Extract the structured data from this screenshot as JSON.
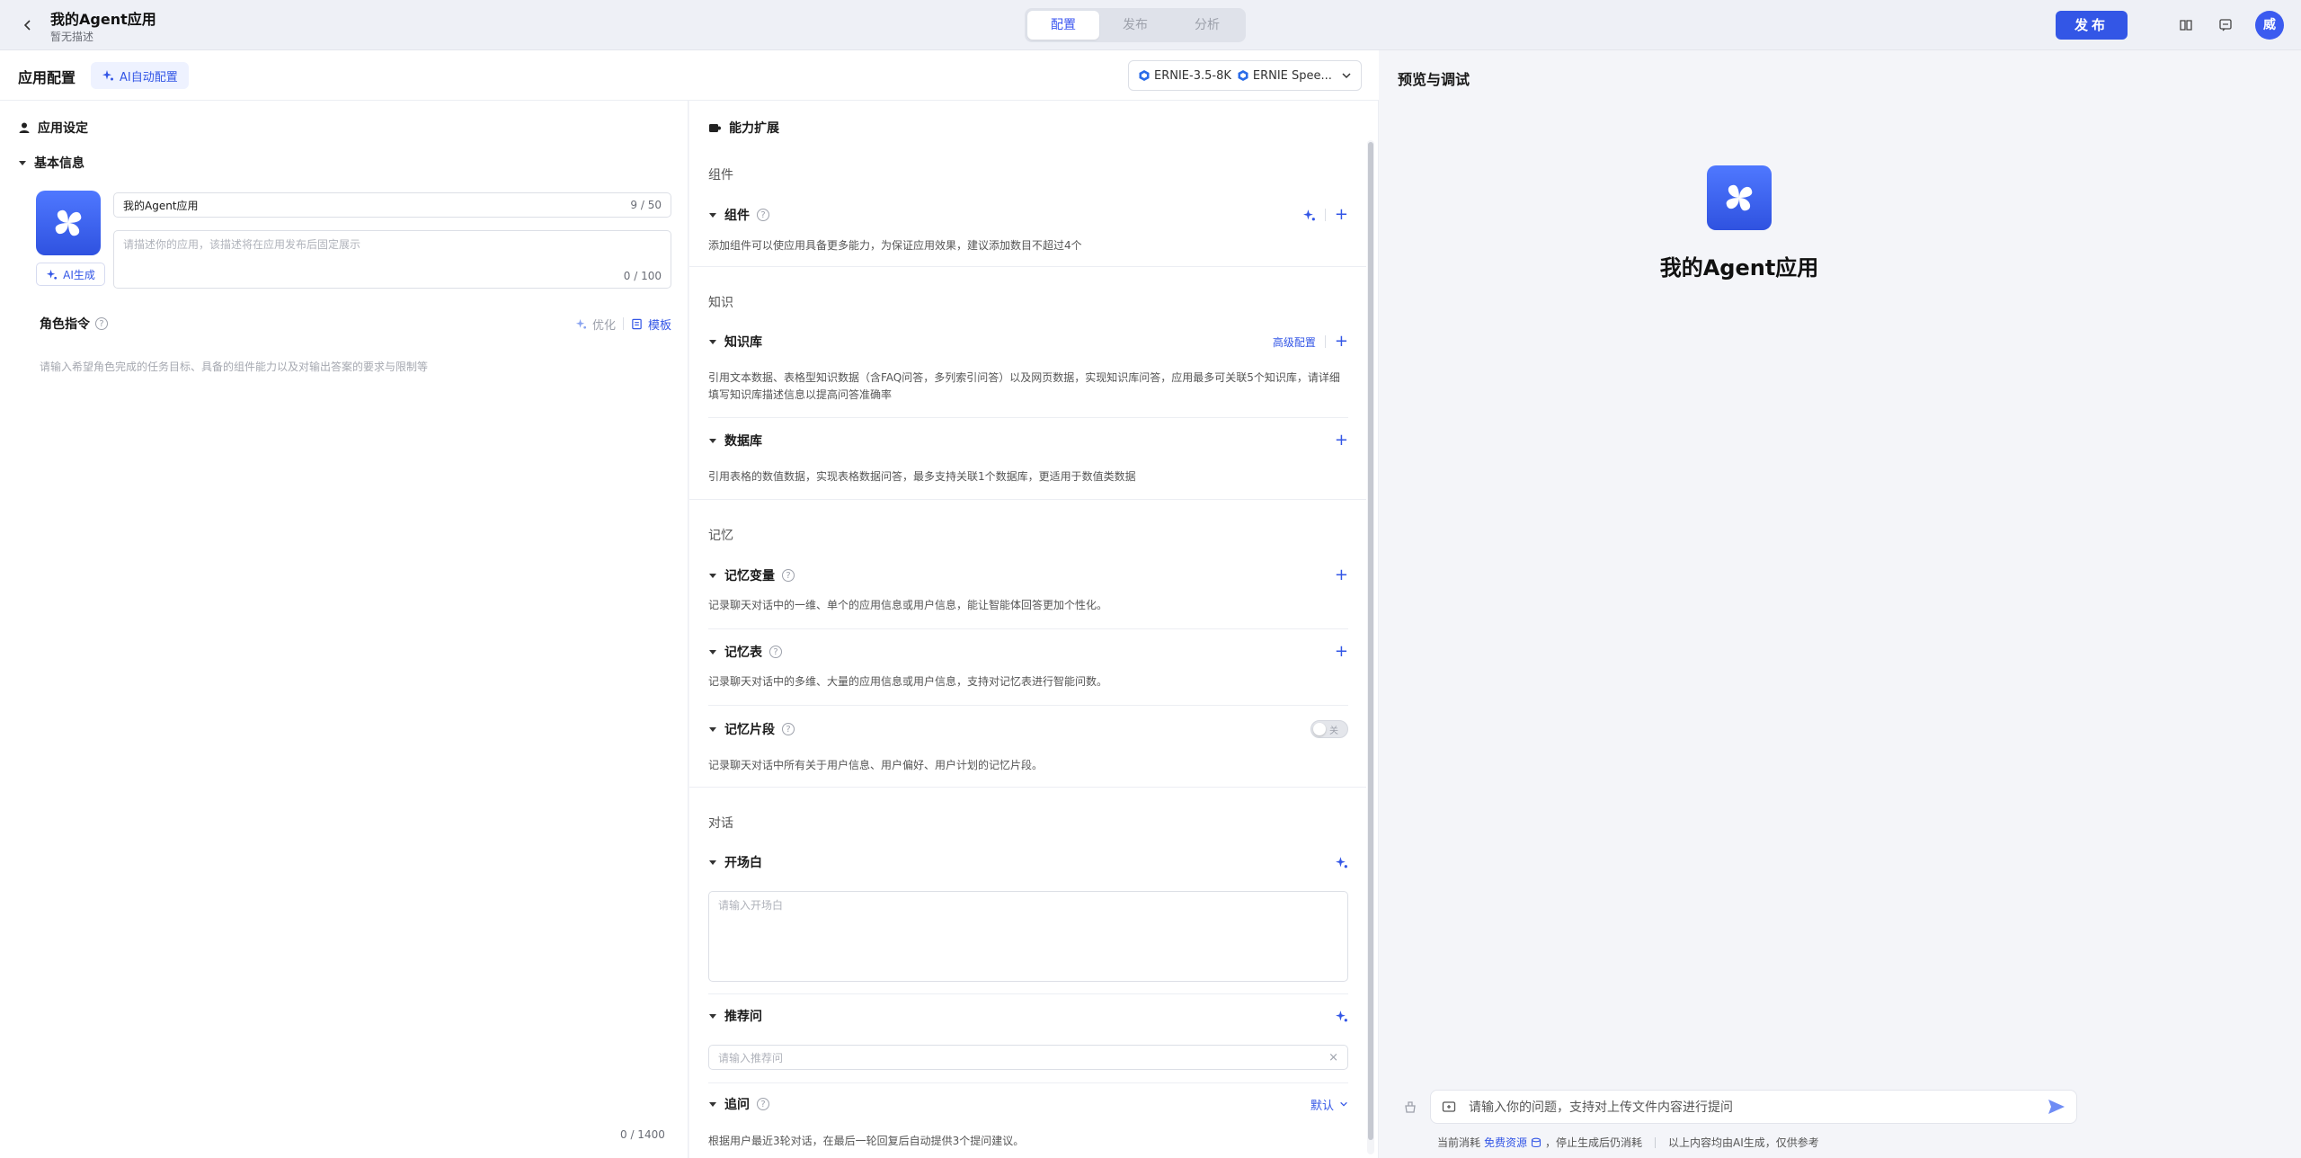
{
  "header": {
    "app_title": "我的Agent应用",
    "app_subtitle": "暂无描述",
    "tabs": [
      {
        "label": "配置",
        "active": true
      },
      {
        "label": "发布",
        "active": false
      },
      {
        "label": "分析",
        "active": false
      }
    ],
    "publish_label": "发布",
    "avatar_text": "威",
    "icons": [
      "back-icon",
      "book-icon",
      "message-icon"
    ],
    "accent_color": "#3356e6"
  },
  "config": {
    "title": "应用配置",
    "ai_auto_label": "AI自动配置",
    "models": [
      "ERNIE-3.5-8K",
      "ERNIE Spee..."
    ]
  },
  "left": {
    "app_settings_title": "应用设定",
    "basic_info_title": "基本信息",
    "ai_generate_label": "AI生成",
    "name_value": "我的Agent应用",
    "name_counter": "9 / 50",
    "desc_placeholder": "请描述你的应用，该描述将在应用发布后固定展示",
    "desc_counter": "0 / 100",
    "role_title": "角色指令",
    "optimize_label": "优化",
    "template_label": "模板",
    "role_placeholder": "请输入希望角色完成的任务目标、具备的组件能力以及对输出答案的要求与限制等",
    "role_counter": "0 / 1400"
  },
  "middle": {
    "title": "能力扩展",
    "groups": {
      "components": "组件",
      "knowledge": "知识",
      "memory": "记忆",
      "dialogue": "对话"
    },
    "component": {
      "title": "组件",
      "desc": "添加组件可以使应用具备更多能力，为保证应用效果，建议添加数目不超过4个"
    },
    "kb": {
      "title": "知识库",
      "advanced_label": "高级配置",
      "desc": "引用文本数据、表格型知识数据（含FAQ问答，多列索引问答）以及网页数据，实现知识库问答，应用最多可关联5个知识库，请详细填写知识库描述信息以提高问答准确率"
    },
    "db": {
      "title": "数据库",
      "desc": "引用表格的数值数据，实现表格数据问答，最多支持关联1个数据库，更适用于数值类数据"
    },
    "mem_var": {
      "title": "记忆变量",
      "desc": "记录聊天对话中的一维、单个的应用信息或用户信息，能让智能体回答更加个性化。"
    },
    "mem_table": {
      "title": "记忆表",
      "desc": "记录聊天对话中的多维、大量的应用信息或用户信息，支持对记忆表进行智能问数。"
    },
    "mem_snip": {
      "title": "记忆片段",
      "toggle_label": "关",
      "desc": "记录聊天对话中所有关于用户信息、用户偏好、用户计划的记忆片段。"
    },
    "opening": {
      "title": "开场白",
      "placeholder": "请输入开场白"
    },
    "recommend": {
      "title": "推荐问",
      "placeholder": "请输入推荐问"
    },
    "followup": {
      "title": "追问",
      "default_label": "默认",
      "desc": "根据用户最近3轮对话，在最后一轮回复后自动提供3个提问建议。"
    }
  },
  "preview": {
    "title": "预览与调试",
    "app_name": "我的Agent应用",
    "input_placeholder": "请输入你的问题，支持对上传文件内容进行提问",
    "footer_prefix": "当前消耗",
    "footer_link": "免费资源",
    "footer_mid": "，停止生成后仍消耗",
    "footer_note": "以上内容均由AI生成，仅供参考"
  }
}
